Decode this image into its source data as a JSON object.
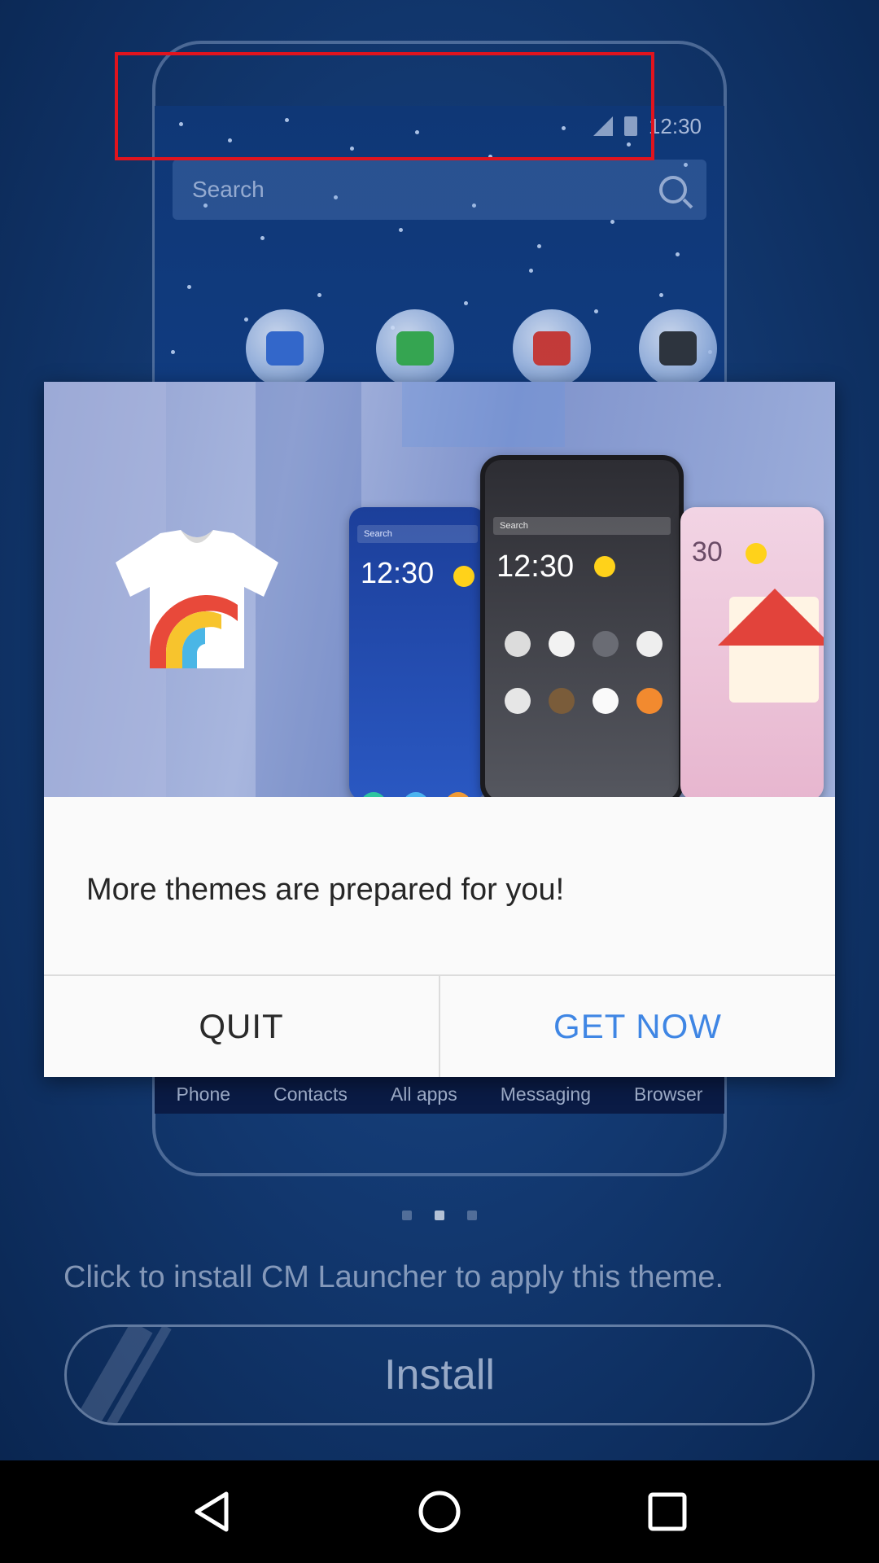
{
  "background": {
    "status_time": "12:30",
    "search_placeholder": "Search",
    "dock_labels": [
      "Phone",
      "Contacts",
      "All apps",
      "Messaging",
      "Browser"
    ],
    "page_indicator": {
      "count": 3,
      "active": 2
    },
    "install_hint": "Click to install CM Launcher to apply this theme.",
    "install_label": "Install"
  },
  "banner": {
    "phones": [
      {
        "time": "12:30",
        "search": "Search"
      },
      {
        "time": "12:30",
        "search": "Search"
      },
      {
        "time": "30"
      }
    ]
  },
  "dialog": {
    "message": "More themes are prepared for you!",
    "quit_label": "QUIT",
    "get_now_label": "GET NOW"
  },
  "colors": {
    "accent": "#3f86e4",
    "highlight_box": "#e0141e"
  },
  "navbar": {
    "icons": [
      "back-icon",
      "home-icon",
      "recents-icon"
    ]
  }
}
